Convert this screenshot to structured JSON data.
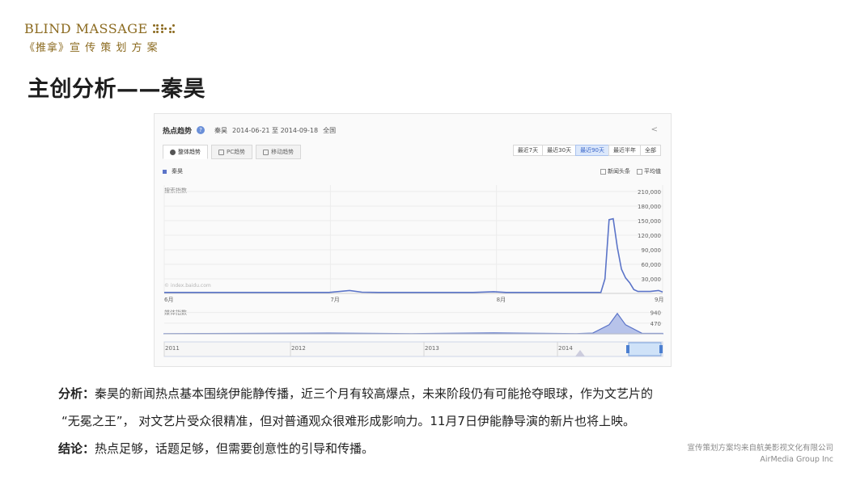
{
  "logo": {
    "english": "BLIND MASSAGE",
    "chinese": "《推拿》宣 传 策 划 方 案"
  },
  "title": "主创分析——秦昊",
  "panel": {
    "header_title": "热点趋势",
    "help_icon": "?",
    "keyword": "秦昊",
    "date_range": "2014-06-21 至 2014-09-18",
    "region": "全国",
    "share_icon": "share-icon",
    "tabs": [
      {
        "label": "整体趋势",
        "active": true,
        "icon": "chart-pie-icon"
      },
      {
        "label": "PC趋势",
        "active": false,
        "icon": "monitor-icon"
      },
      {
        "label": "移动趋势",
        "active": false,
        "icon": "phone-icon"
      }
    ],
    "ranges": [
      {
        "label": "最近7天",
        "active": false
      },
      {
        "label": "最近30天",
        "active": false
      },
      {
        "label": "最近90天",
        "active": true
      },
      {
        "label": "最近半年",
        "active": false
      },
      {
        "label": "全部",
        "active": false
      }
    ],
    "legend_label": "秦昊",
    "legend_color": "#5b74c8",
    "option_news": "新闻头条",
    "option_average": "平均值",
    "search_index_label": "搜索指数",
    "media_index_label": "媒体指数",
    "watermark": "© index.baidu.com"
  },
  "chart_data": [
    {
      "type": "line",
      "ylabel": "搜索指数",
      "ylim": [
        0,
        210000
      ],
      "yticks": [
        "210,000",
        "180,000",
        "150,000",
        "120,000",
        "90,000",
        "60,000",
        "30,000"
      ],
      "xticks": [
        "6月",
        "7月",
        "8月",
        "9月"
      ],
      "series": [
        {
          "name": "秦昊",
          "color": "#5b74c8",
          "x": [
            0,
            10,
            20,
            40,
            45,
            48,
            52,
            60,
            75,
            80,
            83,
            86,
            90,
            96,
            100,
            103,
            106,
            107,
            108,
            109,
            110,
            111,
            112,
            113,
            114,
            115,
            116,
            118,
            120,
            121
          ],
          "y": [
            2000,
            2000,
            2000,
            2000,
            6000,
            2500,
            2000,
            2000,
            2000,
            3500,
            2000,
            2000,
            2000,
            2000,
            2000,
            2000,
            2000,
            30000,
            152000,
            154000,
            95000,
            50000,
            32000,
            22000,
            8000,
            4000,
            4000,
            4000,
            6000,
            3000
          ]
        }
      ]
    },
    {
      "type": "area",
      "ylabel": "媒体指数",
      "ylim": [
        0,
        1000
      ],
      "yticks": [
        "940",
        "470"
      ],
      "series": [
        {
          "name": "秦昊",
          "color": "#5b74c8",
          "x": [
            0,
            40,
            60,
            80,
            100,
            104,
            108,
            110,
            112,
            116,
            121
          ],
          "y": [
            10,
            30,
            10,
            40,
            10,
            30,
            400,
            900,
            400,
            20,
            20
          ]
        }
      ]
    }
  ],
  "timeline": {
    "years": [
      "2011",
      "2012",
      "2013",
      "2014"
    ]
  },
  "analysis": {
    "label": "分析：",
    "text_line1": "秦昊的新闻热点基本围绕伊能静传播，近三个月有较高爆点，未来阶段仍有可能抢夺眼球，作为文艺片的",
    "text_line2": "“无冕之王”， 对文艺片受众很精准，但对普通观众很难形成影响力。11月7日伊能静导演的新片也将上映。",
    "conclusion_label": "结论：",
    "conclusion_text": "热点足够，话题足够，但需要创意性的引导和传播。"
  },
  "footer": {
    "line1": "宣传策划方案均来自航美影视文化有限公司",
    "line2": "AirMedia Group Inc"
  }
}
